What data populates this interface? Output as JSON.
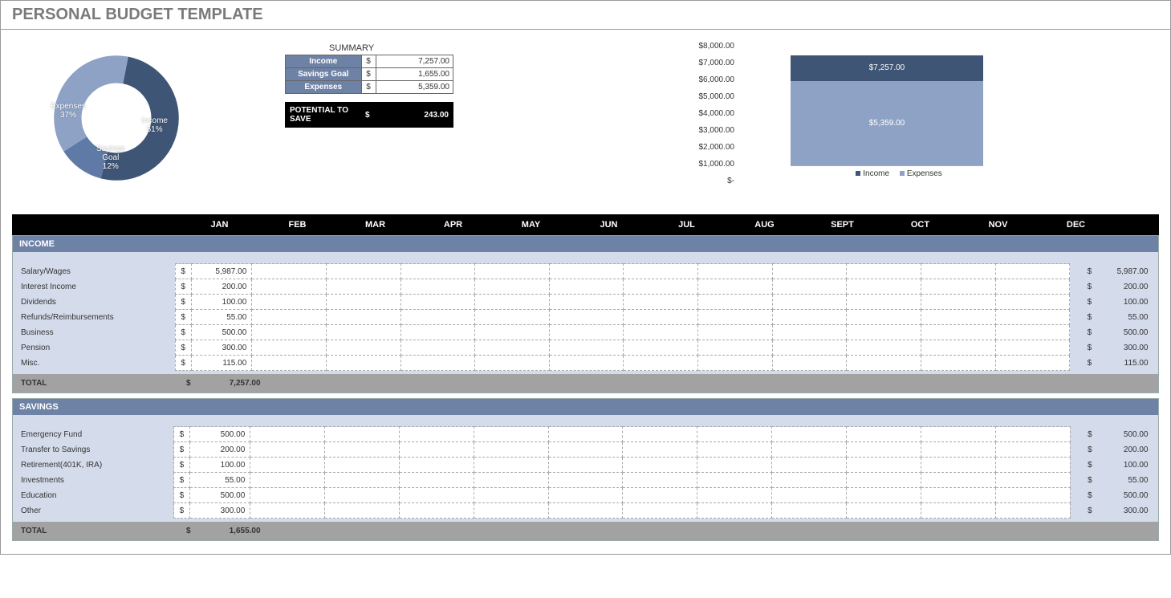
{
  "title": "PERSONAL BUDGET TEMPLATE",
  "summary": {
    "caption": "SUMMARY",
    "rows": [
      {
        "label": "Income",
        "cur": "$",
        "value": "7,257.00"
      },
      {
        "label": "Savings Goal",
        "cur": "$",
        "value": "1,655.00"
      },
      {
        "label": "Expenses",
        "cur": "$",
        "value": "5,359.00"
      }
    ],
    "potential_label": "POTENTIAL TO SAVE",
    "potential_cur": "$",
    "potential_value": "243.00"
  },
  "donut": {
    "income": {
      "label": "Income",
      "pct": "51%"
    },
    "savings": {
      "label": "Savings\nGoal",
      "pct": "12%"
    },
    "expenses": {
      "label": "Expenses",
      "pct": "37%"
    }
  },
  "axis_ticks": [
    "$8,000.00",
    "$7,000.00",
    "$6,000.00",
    "$5,000.00",
    "$4,000.00",
    "$3,000.00",
    "$2,000.00",
    "$1,000.00",
    "$-"
  ],
  "bars": {
    "income": {
      "label": "$7,257.00"
    },
    "expenses": {
      "label": "$5,359.00"
    },
    "legend_income": "Income",
    "legend_expenses": "Expenses"
  },
  "months": [
    "JAN",
    "FEB",
    "MAR",
    "APR",
    "MAY",
    "JUN",
    "JUL",
    "AUG",
    "SEPT",
    "OCT",
    "NOV",
    "DEC"
  ],
  "sections": {
    "income": {
      "title": "INCOME",
      "rows": [
        {
          "label": "Salary/Wages",
          "jan": "5,987.00",
          "total": "5,987.00"
        },
        {
          "label": "Interest Income",
          "jan": "200.00",
          "total": "200.00"
        },
        {
          "label": "Dividends",
          "jan": "100.00",
          "total": "100.00"
        },
        {
          "label": "Refunds/Reimbursements",
          "jan": "55.00",
          "total": "55.00"
        },
        {
          "label": "Business",
          "jan": "500.00",
          "total": "500.00"
        },
        {
          "label": "Pension",
          "jan": "300.00",
          "total": "300.00"
        },
        {
          "label": "Misc.",
          "jan": "115.00",
          "total": "115.00"
        }
      ],
      "total_label": "TOTAL",
      "total_cur": "$",
      "total_value": "7,257.00"
    },
    "savings": {
      "title": "SAVINGS",
      "rows": [
        {
          "label": "Emergency Fund",
          "jan": "500.00",
          "total": "500.00"
        },
        {
          "label": "Transfer to Savings",
          "jan": "200.00",
          "total": "200.00"
        },
        {
          "label": "Retirement(401K, IRA)",
          "jan": "100.00",
          "total": "100.00"
        },
        {
          "label": "Investments",
          "jan": "55.00",
          "total": "55.00"
        },
        {
          "label": "Education",
          "jan": "500.00",
          "total": "500.00"
        },
        {
          "label": "Other",
          "jan": "300.00",
          "total": "300.00"
        }
      ],
      "total_label": "TOTAL",
      "total_cur": "$",
      "total_value": "1,655.00"
    }
  },
  "cur": "$",
  "chart_data": [
    {
      "type": "pie",
      "series": [
        {
          "name": "Income",
          "value": 51
        },
        {
          "name": "Savings Goal",
          "value": 12
        },
        {
          "name": "Expenses",
          "value": 37
        }
      ],
      "title": "",
      "hole": 0.55
    },
    {
      "type": "bar",
      "categories": [
        "Income",
        "Expenses"
      ],
      "values": [
        7257.0,
        5359.0
      ],
      "ylim": [
        0,
        8000
      ],
      "ylabel": "$",
      "title": ""
    }
  ]
}
